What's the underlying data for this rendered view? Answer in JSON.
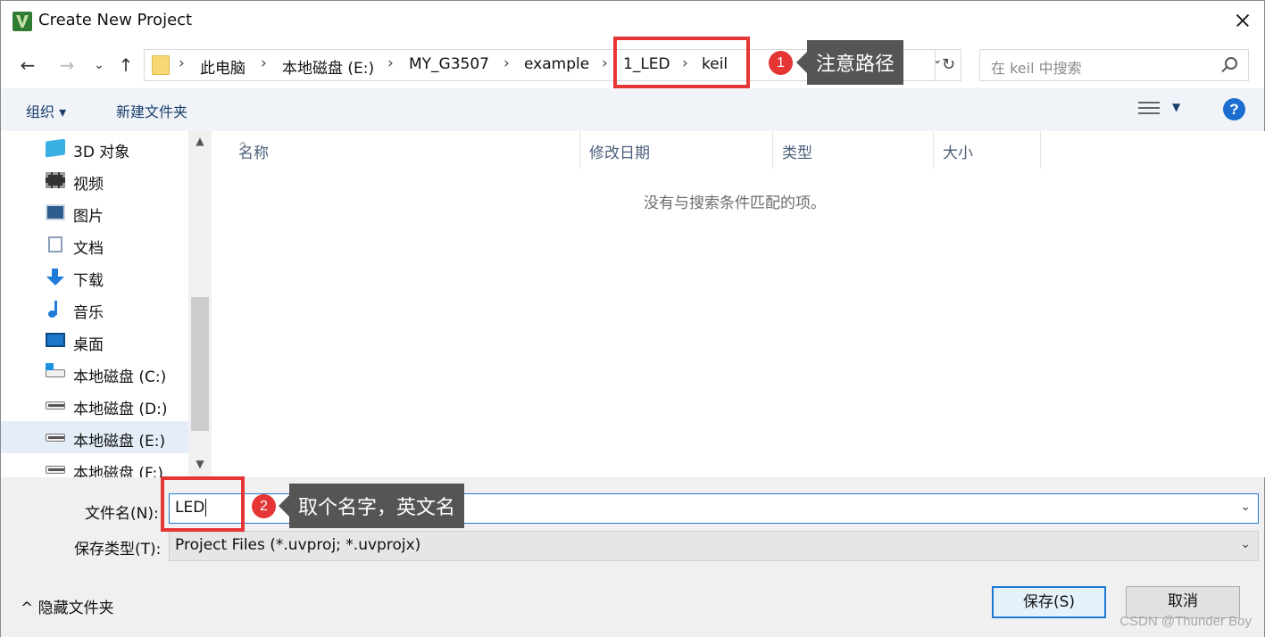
{
  "window": {
    "title": "Create New Project",
    "close_glyph": "✕"
  },
  "nav": {
    "back": "←",
    "forward": "→",
    "recent": "⌄",
    "up": "↑"
  },
  "address": {
    "crumbs": [
      "此电脑",
      "本地磁盘 (E:)",
      "MY_G3507",
      "example",
      "1_LED",
      "keil"
    ],
    "separator": "›",
    "refresh": "↻",
    "dropdown": "⌄"
  },
  "search": {
    "placeholder": "在 keil 中搜索"
  },
  "toolbar": {
    "organize": "组织 ▾",
    "new_folder": "新建文件夹",
    "view_caret": "▼",
    "help": "?"
  },
  "sidebar": {
    "items": [
      {
        "label": "3D 对象",
        "icon": "cube-icon"
      },
      {
        "label": "视频",
        "icon": "video-icon"
      },
      {
        "label": "图片",
        "icon": "pictures-icon"
      },
      {
        "label": "文档",
        "icon": "documents-icon"
      },
      {
        "label": "下载",
        "icon": "download-icon"
      },
      {
        "label": "音乐",
        "icon": "music-icon"
      },
      {
        "label": "桌面",
        "icon": "desktop-icon"
      },
      {
        "label": "本地磁盘 (C:)",
        "icon": "drive-c-icon"
      },
      {
        "label": "本地磁盘 (D:)",
        "icon": "drive-icon"
      },
      {
        "label": "本地磁盘 (E:)",
        "icon": "drive-icon",
        "selected": true
      },
      {
        "label": "本地磁盘 (F:)",
        "icon": "drive-icon"
      }
    ],
    "scroll_up": "▲",
    "scroll_down": "▼"
  },
  "filelist": {
    "columns": [
      "名称",
      "修改日期",
      "类型",
      "大小"
    ],
    "sort_caret": "^",
    "empty_message": "没有与搜索条件匹配的项。"
  },
  "form": {
    "filename_label": "文件名(N):",
    "filename_value": "LED",
    "filetype_label": "保存类型(T):",
    "filetype_value": "Project Files (*.uvproj; *.uvprojx)",
    "caret": "⌄"
  },
  "footer": {
    "hide_folders": "^  隐藏文件夹",
    "save": "保存(S)",
    "cancel": "取消"
  },
  "annotations": {
    "badge1": "1",
    "note1": "注意路径",
    "badge2": "2",
    "note2": "取个名字，英文名",
    "color": "#e53535"
  },
  "watermark": "CSDN @Thunder Boy"
}
